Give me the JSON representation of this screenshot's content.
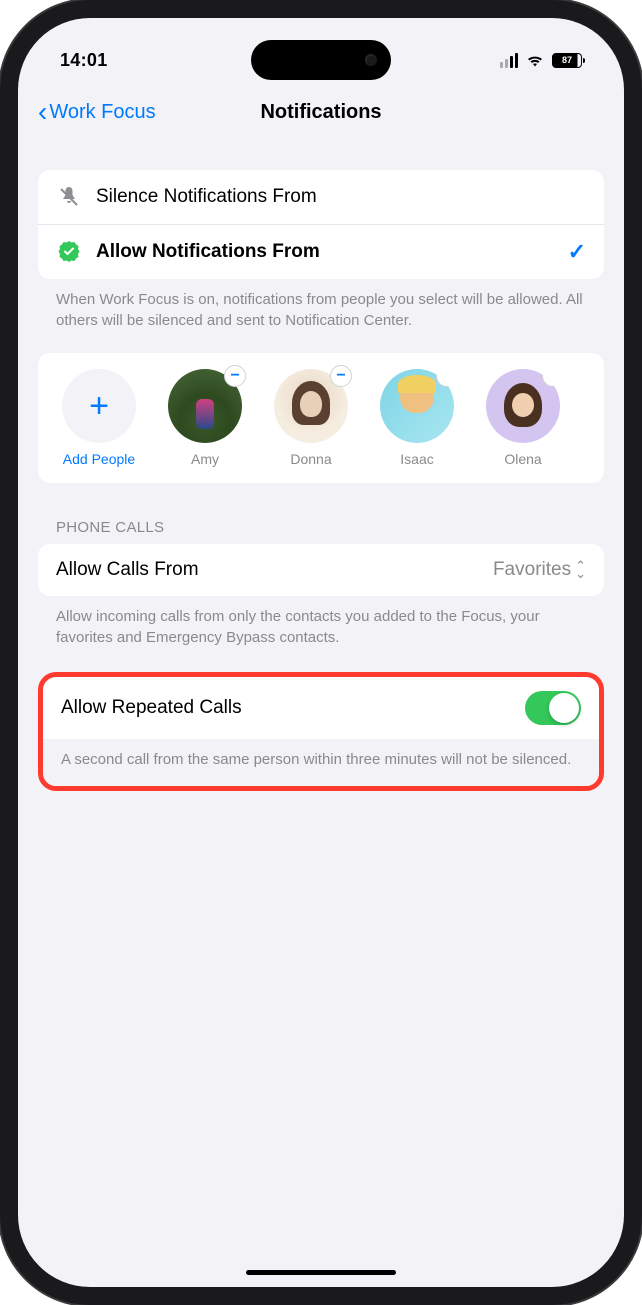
{
  "status": {
    "time": "14:01",
    "battery": "87"
  },
  "nav": {
    "back_label": "Work Focus",
    "title": "Notifications"
  },
  "mode_group": {
    "silence_label": "Silence Notifications From",
    "allow_label": "Allow Notifications From",
    "selected": "allow"
  },
  "mode_footer": "When Work Focus is on, notifications from people you select will be allowed. All others will be silenced and sent to Notification Center.",
  "people": {
    "add_label": "Add People",
    "items": [
      {
        "name": "Amy"
      },
      {
        "name": "Donna"
      },
      {
        "name": "Isaac"
      },
      {
        "name": "Olena"
      }
    ]
  },
  "phone_section": {
    "header": "PHONE CALLS",
    "allow_calls_label": "Allow Calls From",
    "allow_calls_value": "Favorites",
    "footer": "Allow incoming calls from only the contacts you added to the Focus, your favorites and Emergency Bypass contacts."
  },
  "repeated": {
    "label": "Allow Repeated Calls",
    "enabled": true,
    "footer": "A second call from the same person within three minutes will not be silenced."
  }
}
